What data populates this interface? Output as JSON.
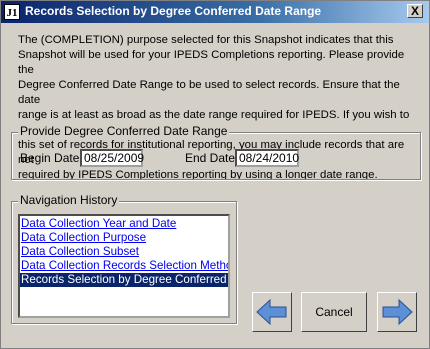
{
  "window": {
    "title": "Records Selection by Degree Conferred Date Range",
    "app_icon": "J1",
    "close_label": "X"
  },
  "description": "The (COMPLETION) purpose selected for this Snapshot indicates that this\nSnapshot will be used for your IPEDS Completions reporting.  Please provide the\nDegree Conferred Date Range to be used to select records.  Ensure that the date\nrange is at least as broad as the date range required for  IPEDS.  If  you wish to use\nthis set of records for institutional reporting, you may include records that are not\nrequired by IPEDS Completions reporting by using a longer date range.",
  "date_range": {
    "group_label": "Provide Degree Conferred Date Range",
    "begin_label": "Begin Date:",
    "begin_value": "08/25/2009",
    "end_label": "End Date:",
    "end_value": "08/24/2010"
  },
  "navigation": {
    "group_label": "Navigation History",
    "items": [
      {
        "label": "Data Collection Year and Date"
      },
      {
        "label": "Data Collection Purpose"
      },
      {
        "label": "Data Collection Subset"
      },
      {
        "label": "Data Collection Records Selection Method"
      },
      {
        "label": "Records Selection by Degree Conferred Date"
      }
    ],
    "selected_index": 4
  },
  "buttons": {
    "back_icon": "left-arrow-icon",
    "cancel_label": "Cancel",
    "next_icon": "right-arrow-icon"
  },
  "colors": {
    "title_bar": "#0a246a",
    "arrow_fill": "#5b8fd6",
    "selection": "#0a246a",
    "link": "#0000ee"
  }
}
